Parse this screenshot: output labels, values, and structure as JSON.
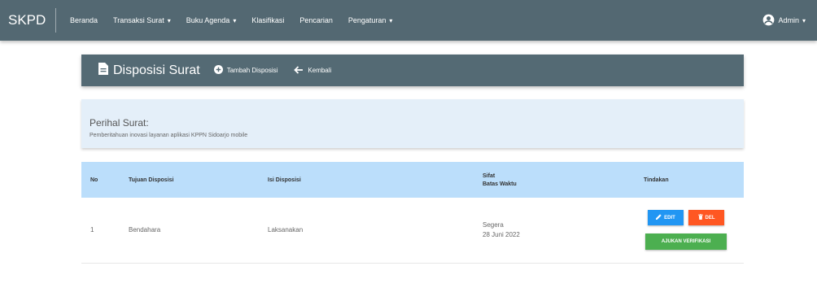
{
  "navbar": {
    "brand": "SKPD",
    "items": [
      {
        "label": "Beranda",
        "dropdown": false
      },
      {
        "label": "Transaksi Surat",
        "dropdown": true
      },
      {
        "label": "Buku Agenda",
        "dropdown": true
      },
      {
        "label": "Klasifikasi",
        "dropdown": false
      },
      {
        "label": "Pencarian",
        "dropdown": false
      },
      {
        "label": "Pengaturan",
        "dropdown": true
      }
    ],
    "user": "Admin"
  },
  "header": {
    "title": "Disposisi Surat",
    "add_label": "Tambah Disposisi",
    "back_label": "Kembali"
  },
  "perihal": {
    "label": "Perihal Surat:",
    "text": "Pemberitahuan inovasi layanan aplikasi KPPN Sidoarjo mobile"
  },
  "table": {
    "headers": {
      "no": "No",
      "tujuan": "Tujuan Disposisi",
      "isi": "Isi Disposisi",
      "sifat": "Sifat",
      "batas": "Batas Waktu",
      "tindakan": "Tindakan"
    },
    "rows": [
      {
        "no": "1",
        "tujuan": "Bendahara",
        "isi": "Laksanakan",
        "sifat": "Segera",
        "batas": "28 Juni 2022",
        "edit_label": "EDIT",
        "delete_label": "DEL",
        "verify_label": "AJUKAN VERIFIKASI"
      }
    ]
  },
  "colors": {
    "navbar": "#536872",
    "header_card": "#546a74",
    "perihal_bg": "#e4eff9",
    "table_head": "#bbdefb",
    "edit": "#2196f3",
    "delete": "#ff5722",
    "verify": "#4caf50"
  }
}
